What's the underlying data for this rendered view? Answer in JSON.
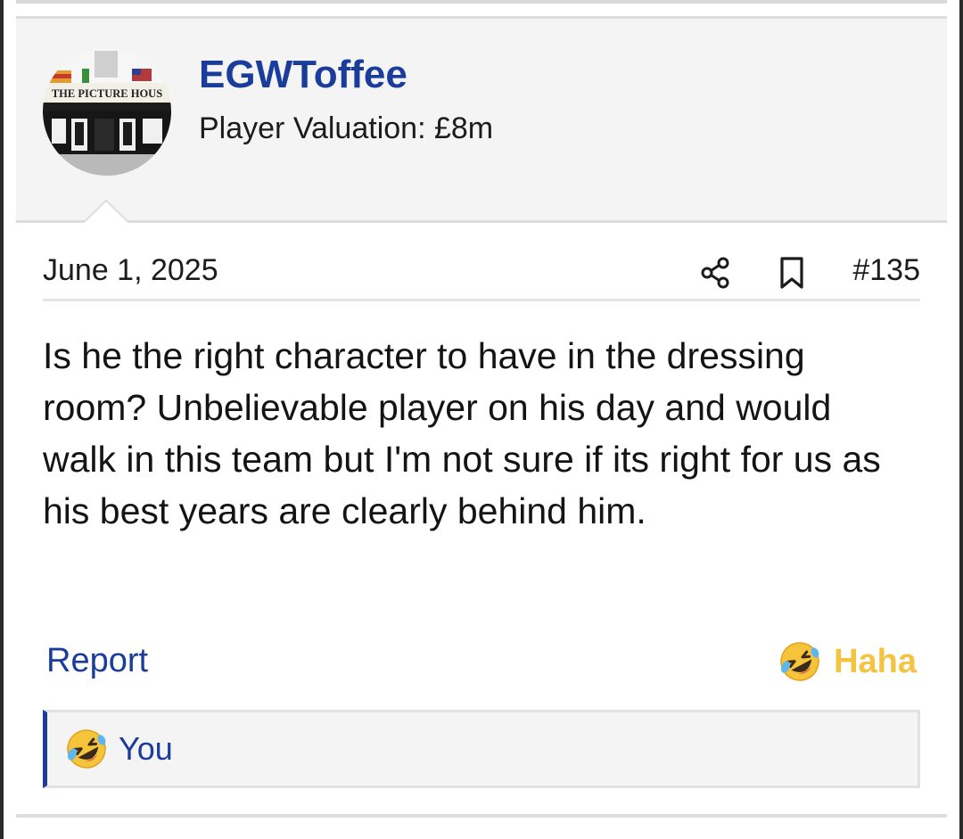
{
  "user": {
    "name": "EGWToffee",
    "valuation": "Player Valuation: £8m",
    "avatar_sign_text": "THE PICTURE HOUS"
  },
  "post": {
    "date": "June 1, 2025",
    "number": "#135",
    "body": "Is he the right character to have in the dressing room? Unbelievable player on his day and would walk in this team but I'm not sure if its right for us as his best years are clearly behind him.",
    "icons": [
      "share-icon",
      "bookmark-icon"
    ]
  },
  "actions": {
    "report_label": "Report",
    "reaction_label": "Haha",
    "reaction_icon": "rofl-emoji-icon"
  },
  "reactions_summary": {
    "label": "You",
    "icon": "rofl-emoji-icon"
  },
  "colors": {
    "link_blue": "#1a3d9c",
    "haha_yellow": "#f4c341",
    "panel_bg": "#f4f4f4"
  }
}
